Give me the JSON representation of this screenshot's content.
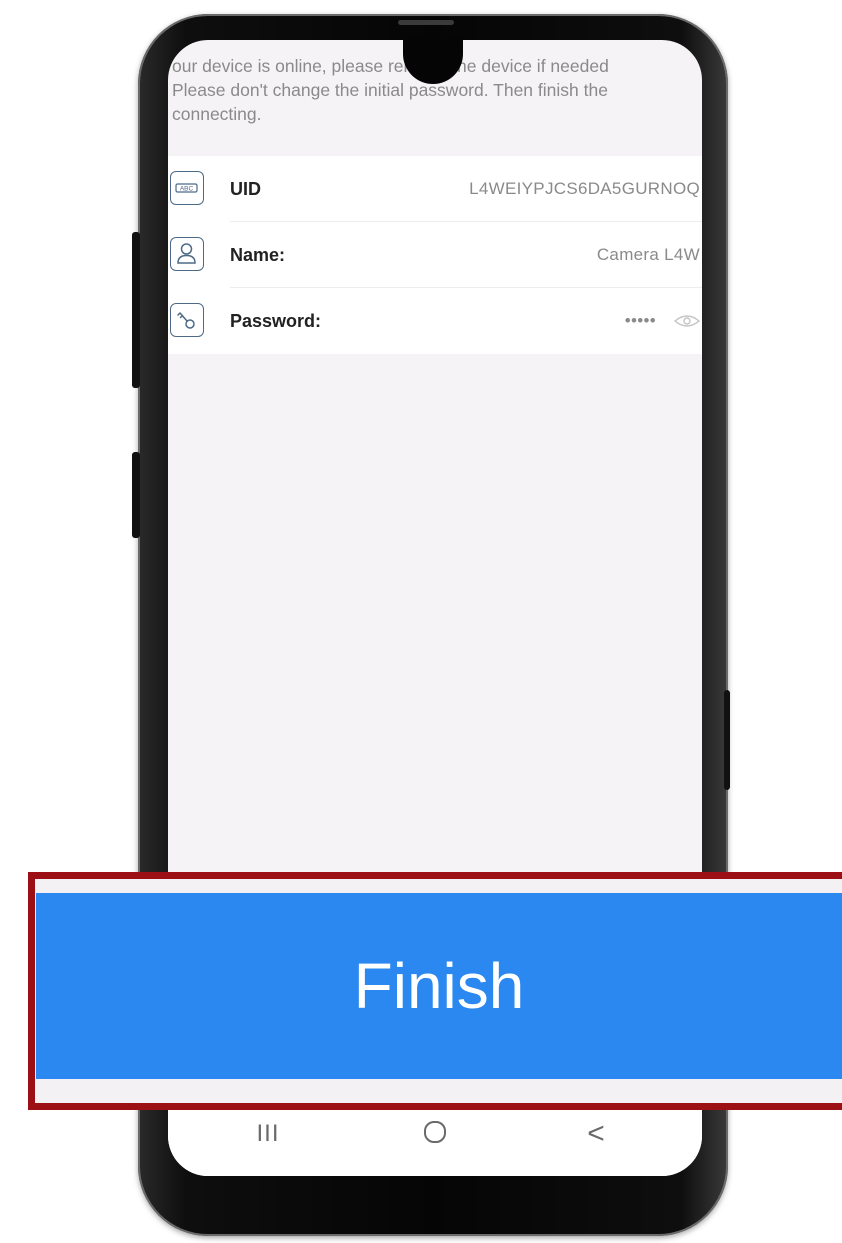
{
  "notice": {
    "line1": "our device is online, please rename the device if needed",
    "line2": "Please don't change the initial password. Then finish the",
    "line3": "connecting."
  },
  "device": {
    "uid_label": "UID",
    "uid_value": "L4WEIYPJCS6DA5GURNOQ",
    "name_label": "Name:",
    "name_value": "Camera L4W",
    "password_label": "Password:",
    "password_value": "•••••"
  },
  "action": {
    "finish_label": "Finish"
  },
  "nav": {
    "recents_glyph": "III",
    "home_glyph": "O",
    "back_glyph": "<"
  },
  "colors": {
    "accent": "#2a88f0",
    "highlight_frame": "#9c0f14",
    "icon_stroke": "#4d6a86"
  }
}
